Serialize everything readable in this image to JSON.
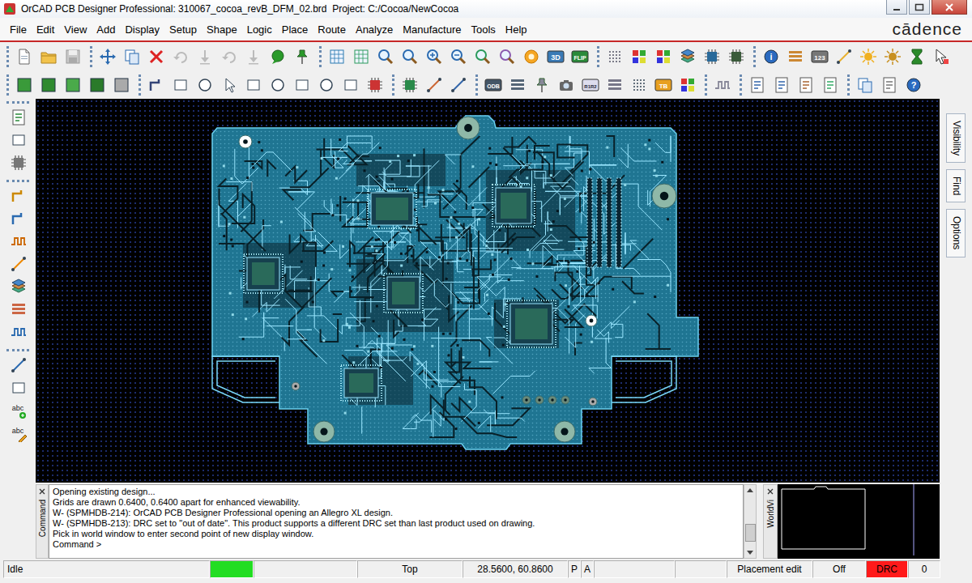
{
  "window": {
    "title": "OrCAD PCB Designer Professional: 310067_cocoa_revB_DFM_02.brd  Project: C:/Cocoa/NewCocoa"
  },
  "menu": [
    "File",
    "Edit",
    "View",
    "Add",
    "Display",
    "Setup",
    "Shape",
    "Logic",
    "Place",
    "Route",
    "Analyze",
    "Manufacture",
    "Tools",
    "Help"
  ],
  "brand": "cādence",
  "toolbar_labels": {
    "d3": "3D",
    "flip": "FLIP",
    "num": "123",
    "odb": "ODB",
    "r1r2": "R1R2",
    "tb": "TB",
    "info": "i",
    "help": "?",
    "abc_add": "abc",
    "abc_edit": "abc"
  },
  "side_tabs": [
    "Visibility",
    "Find",
    "Options"
  ],
  "command_panel": {
    "title": "Command",
    "lines": [
      "Opening existing design...",
      "Grids are drawn 0.6400, 0.6400 apart for enhanced viewability.",
      "W- (SPMHDB-214): OrCAD PCB Designer Professional opening an Allegro XL design.",
      "W- (SPMHDB-213): DRC set to \"out of date\". This product supports a different DRC set than last product used on drawing.",
      "Pick in world window to enter second point of new display window.",
      "Command >"
    ]
  },
  "world_view": {
    "title": "WorldVi"
  },
  "status_bar": {
    "mode": "Idle",
    "ready": true,
    "layer": "Top",
    "coords": "28.5600, 60.8600",
    "toggles": [
      "P",
      "A"
    ],
    "edit_mode": "Placement edit",
    "snap": "Off",
    "drc": {
      "label": "DRC",
      "out_of_date": true
    },
    "drc_count": "0"
  }
}
